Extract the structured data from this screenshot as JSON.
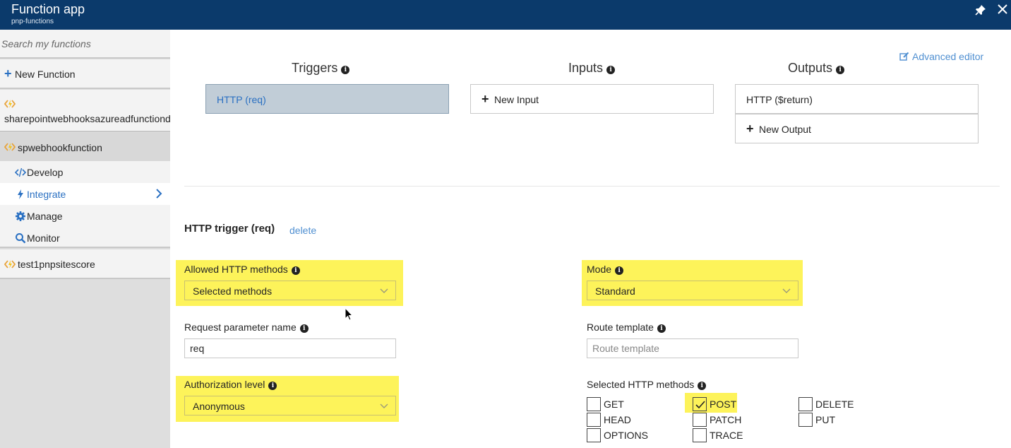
{
  "header": {
    "title": "Function app",
    "subtitle": "pnp-functions"
  },
  "sidebar": {
    "search_placeholder": "Search my functions",
    "new_function": "New Function",
    "functions": [
      {
        "name": "sharepointwebhooksazureadfunctiond"
      },
      {
        "name": "spwebhookfunction"
      },
      {
        "name": "test1pnpsitescore"
      }
    ],
    "sub_items": [
      {
        "label": "Develop",
        "icon": "code-icon"
      },
      {
        "label": "Integrate",
        "icon": "lightning-icon",
        "selected": true
      },
      {
        "label": "Manage",
        "icon": "gear-icon"
      },
      {
        "label": "Monitor",
        "icon": "search-icon"
      }
    ]
  },
  "main": {
    "advanced_editor": "Advanced editor",
    "triggers": {
      "title": "Triggers",
      "items": [
        "HTTP (req)"
      ]
    },
    "inputs": {
      "title": "Inputs",
      "new_label": "New Input"
    },
    "outputs": {
      "title": "Outputs",
      "items": [
        "HTTP ($return)"
      ],
      "new_label": "New Output"
    },
    "section_title": "HTTP trigger (req)",
    "delete_label": "delete",
    "form": {
      "allowed_methods_label": "Allowed HTTP methods",
      "allowed_methods_value": "Selected methods",
      "mode_label": "Mode",
      "mode_value": "Standard",
      "request_param_label": "Request parameter name",
      "request_param_value": "req",
      "route_template_label": "Route template",
      "route_template_placeholder": "Route template",
      "auth_level_label": "Authorization level",
      "auth_level_value": "Anonymous",
      "selected_methods_label": "Selected HTTP methods"
    },
    "methods": [
      {
        "name": "GET",
        "checked": false
      },
      {
        "name": "HEAD",
        "checked": false
      },
      {
        "name": "OPTIONS",
        "checked": false
      },
      {
        "name": "POST",
        "checked": true
      },
      {
        "name": "PATCH",
        "checked": false
      },
      {
        "name": "TRACE",
        "checked": false
      },
      {
        "name": "DELETE",
        "checked": false
      },
      {
        "name": "PUT",
        "checked": false
      }
    ]
  },
  "colors": {
    "header_bg": "#0b3a6b",
    "accent": "#2a70c2",
    "highlight": "#fdf35a",
    "trigger_selected": "#c1cdd7"
  }
}
